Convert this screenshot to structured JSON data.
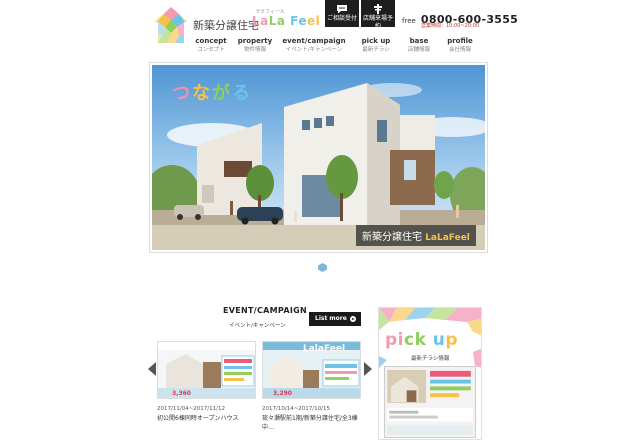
{
  "header": {
    "logo_text": "新築分譲住宅",
    "brand_ruby": "ララフィール",
    "brand": [
      "La",
      "La",
      " Fe",
      "el"
    ],
    "consult_label": "ご相談受付",
    "reserve_label": "店舗来場予約",
    "phone_free": "free",
    "phone_number": "0800-600-3555",
    "phone_hours": "営業時間：10:00~20:00"
  },
  "nav": [
    {
      "en": "concept",
      "jp": "コンセプト"
    },
    {
      "en": "property",
      "jp": "物件情報"
    },
    {
      "en": "event/campaign",
      "jp": "イベント/キャンペーン"
    },
    {
      "en": "pick up",
      "jp": "最新チラシ"
    },
    {
      "en": "base",
      "jp": "店舗情報"
    },
    {
      "en": "profile",
      "jp": "会社情報"
    }
  ],
  "hero": {
    "catch": [
      "つ",
      "な",
      "が",
      "る"
    ],
    "label": "新築分譲住宅",
    "label_brand": "LaLaFeel"
  },
  "event": {
    "title": "EVENT/CAMPAIGN",
    "subtitle": "イベント/キャンペーン",
    "list_more": "List more",
    "cards": [
      {
        "date": "2017/11/04~2017/11/12",
        "name": "初公開6棟同時オープンハウス",
        "banner_price": "3,360"
      },
      {
        "date": "2017/10/14~2017/10/15",
        "name": "琉々瀬駅前1期/新築分譲住宅/全3棟　中…",
        "banner_brand": "LalaFeel",
        "banner_price": "3,290"
      }
    ]
  },
  "pickup": {
    "title": [
      "pi",
      "ck",
      " u",
      "p"
    ],
    "subtitle": "最新チラシ情報"
  },
  "colors": {
    "pink": "#f29ab1",
    "green": "#8fcf5e",
    "blue": "#6cc3e8",
    "yellow": "#f7c04a",
    "dark": "#1e1e1e"
  }
}
